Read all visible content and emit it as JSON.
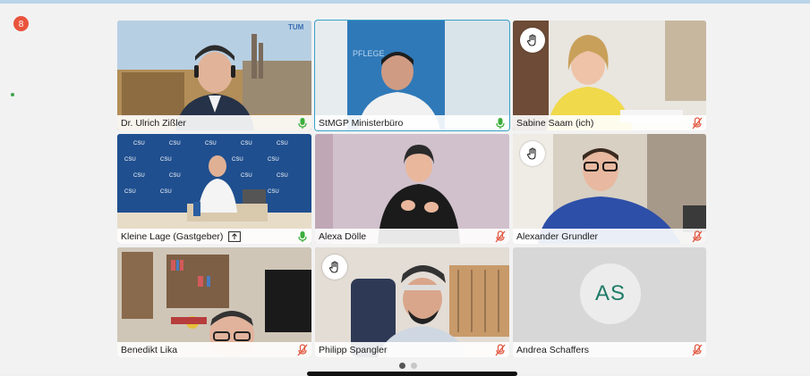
{
  "notification": {
    "count": "8"
  },
  "participants": [
    {
      "name": "Dr. Ulrich Zißler",
      "mic": "on",
      "hand": false,
      "logo": "TUM"
    },
    {
      "name": "StMGP Ministerbüro",
      "mic": "on",
      "hand": false,
      "active": true,
      "wall_text": "PFLEGE"
    },
    {
      "name": "Sabine Saam (ich)",
      "mic": "muted",
      "hand": true
    },
    {
      "name": "Kleine Lage (Gastgeber)",
      "mic": "on",
      "hand": false,
      "sharing": true,
      "backdrop_text": "CSU"
    },
    {
      "name": "Alexa Dölle",
      "mic": "muted",
      "hand": false
    },
    {
      "name": "Alexander Grundler",
      "mic": "muted",
      "hand": true
    },
    {
      "name": "Benedikt Lika",
      "mic": "muted",
      "hand": false
    },
    {
      "name": "Philipp Spangler",
      "mic": "muted",
      "hand": true
    },
    {
      "name": "Andrea Schaffers",
      "mic": "muted",
      "hand": false,
      "initials": "AS"
    }
  ],
  "pager": {
    "pages": 2,
    "current": 1
  },
  "colors": {
    "mic_on": "#3cae3c",
    "mic_muted": "#e0533b",
    "active_outline": "#38a1c7",
    "avatar_text": "#1f7b67"
  }
}
